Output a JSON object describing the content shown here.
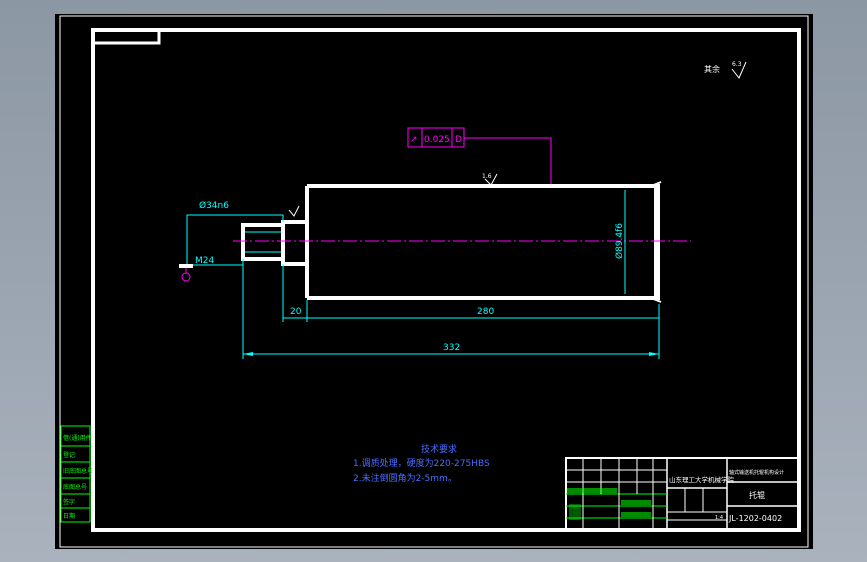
{
  "drawing": {
    "roughness_label": "其余",
    "roughness_value": "6.3",
    "surface_roughness_value": "1.6",
    "tolerance": {
      "symbol": "↗",
      "value": "0.025",
      "datum": "D"
    },
    "dims": {
      "thread_diameter": "Ø34n6",
      "thread_spec": "M24",
      "main_diameter": "Ø89.4f6",
      "len_20": "20",
      "len_280": "280",
      "len_332": "332"
    },
    "tech_requirements": {
      "title": "技术要求",
      "line1": "1.调质处理，硬度为220-275HBS",
      "line2": "2.未注倒圆角为2-5mm。"
    },
    "title_block": {
      "school": "山东理工大学机械学院",
      "part_name": "托辊",
      "project": "轴式输送机托辊机构设计",
      "drawing_no": "JL-1202-0402",
      "scale": "1:4"
    },
    "side_labels": [
      "借(通)用件",
      "登记",
      "旧底图总号",
      "底图总号",
      "签字",
      "日期"
    ]
  },
  "colors": {
    "background": "#000000",
    "border": "#ffffff",
    "dimension": "#00ffff",
    "magenta": "#ff00ff",
    "green": "#00ff00",
    "blue": "#4a6dff"
  }
}
